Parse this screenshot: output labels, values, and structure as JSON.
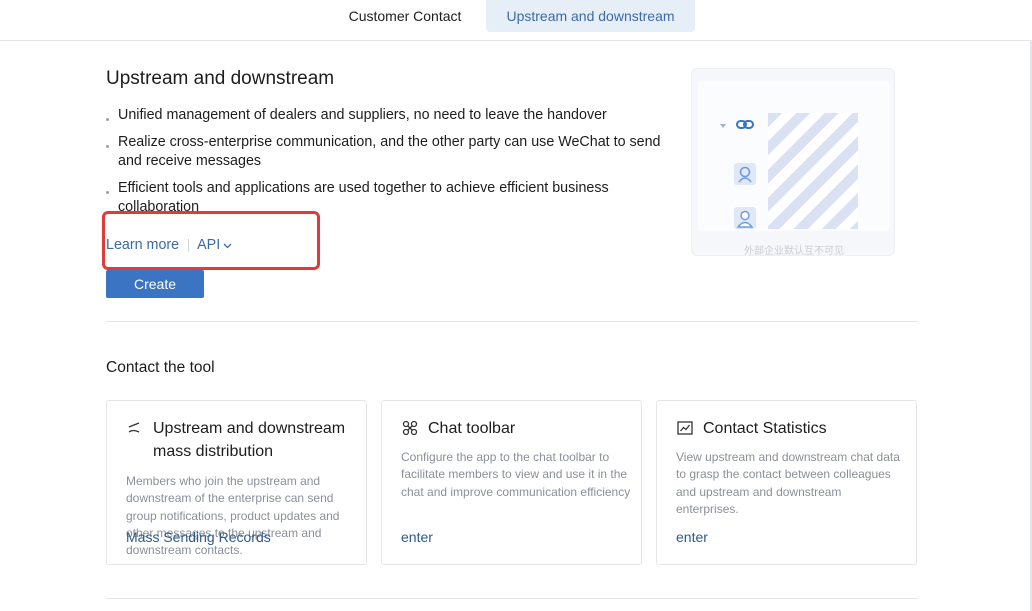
{
  "tabs": [
    {
      "label": "Customer Contact",
      "active": false
    },
    {
      "label": "Upstream and downstream",
      "active": true
    }
  ],
  "section": {
    "title": "Upstream and downstream",
    "bullets": [
      "Unified management of dealers and suppliers, no need to leave the handover",
      "Realize cross-enterprise communication, and the other party can use WeChat to send and receive messages",
      "Efficient tools and applications are used together to achieve efficient business collaboration"
    ],
    "learn_more": "Learn more",
    "api": "API",
    "create": "Create"
  },
  "preview": {
    "caption": "外部企业默认互不可见"
  },
  "tools": {
    "title": "Contact the tool",
    "cards": [
      {
        "icon": "broadcast-icon",
        "title": "Upstream and downstream mass distribution",
        "desc": "Members who join the upstream and downstream of the enterprise can send group notifications, product updates and other messages to the upstream and downstream contacts.",
        "action": "Mass Sending Records"
      },
      {
        "icon": "toolbar-icon",
        "title": "Chat toolbar",
        "desc": "Configure the app to the chat toolbar to facilitate members to view and use it in the chat and improve communication efficiency",
        "action": "enter"
      },
      {
        "icon": "chart-icon",
        "title": "Contact Statistics",
        "desc": "View upstream and downstream chat data to grasp the contact between colleagues and upstream and downstream enterprises.",
        "action": "enter"
      }
    ]
  },
  "colors": {
    "accent": "#3a74c2",
    "link": "#3a6aa5",
    "highlight": "#e03a3a",
    "active_tab_bg": "#e6eef8"
  }
}
